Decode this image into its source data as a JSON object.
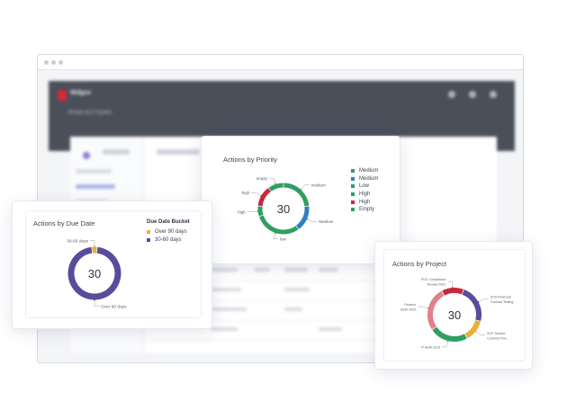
{
  "background_app": {
    "brand": "Wdgov",
    "section": "RISK/ACTIONS",
    "panel_title": "Advance & Action",
    "nav_item": "Dashboard"
  },
  "due_date_card": {
    "title": "Actions by Due Date",
    "center_value": "30",
    "legend_title": "Due Date Bucket",
    "legend": [
      {
        "label": "Over 90 days",
        "color": "#e8b03a"
      },
      {
        "label": "30-60 days",
        "color": "#5b4b9b"
      }
    ]
  },
  "priority_card": {
    "title": "Actions by Priority",
    "center_value": "30",
    "legend": [
      {
        "label": "Medium",
        "color": "#2f9e63"
      },
      {
        "label": "Medium",
        "color": "#2f7fc1"
      },
      {
        "label": "Low",
        "color": "#2f9e63"
      },
      {
        "label": "High",
        "color": "#2f9e63"
      },
      {
        "label": "High",
        "color": "#c8283a"
      },
      {
        "label": "Empty",
        "color": "#2f9e63"
      }
    ]
  },
  "project_card": {
    "title": "Actions by Project",
    "center_value": "30"
  },
  "chart_data": [
    {
      "type": "pie",
      "title": "Actions by Due Date",
      "legend_title": "Due Date Bucket",
      "categories": [
        "30-60 days",
        "Over 90 days"
      ],
      "values": [
        1,
        29
      ],
      "colors": [
        "#e8b03a",
        "#5b4b9b"
      ],
      "slice_labels": [
        "30-60 days",
        "Over 90 days"
      ],
      "center_label": "30",
      "legend_placement": "right"
    },
    {
      "type": "pie",
      "title": "Actions by Priority",
      "categories": [
        "medium",
        "Medium",
        "low",
        "high",
        "high",
        "empty"
      ],
      "values": [
        7,
        5,
        9,
        2,
        4,
        3
      ],
      "colors": [
        "#2f9e63",
        "#2f7fc1",
        "#2f9e63",
        "#2f9e63",
        "#c8283a",
        "#2f9e63"
      ],
      "slice_labels": [
        "medium",
        "Medium",
        "low",
        "high",
        "high",
        "empty"
      ],
      "center_label": "30",
      "legend_placement": "right"
    },
    {
      "type": "pie",
      "title": "Actions by Project",
      "categories": [
        "SOX Financial Controls Testing",
        "SCF Service Controls Prov...",
        "IT Audit 2019",
        "Finance Audit 2020",
        "FDC Compliance Review 2021"
      ],
      "values": [
        7,
        4,
        7,
        8,
        4
      ],
      "colors": [
        "#5b4b9b",
        "#e8b03a",
        "#2f9e63",
        "#e37f8a",
        "#c8283a"
      ],
      "slice_labels": [
        "SOX Financial Controls Testing",
        "SCF Service Controls Prov...",
        "IT Audit 2019",
        "Finance Audit 2020",
        "FDC Compliance Review 2021"
      ],
      "center_label": "30"
    }
  ]
}
